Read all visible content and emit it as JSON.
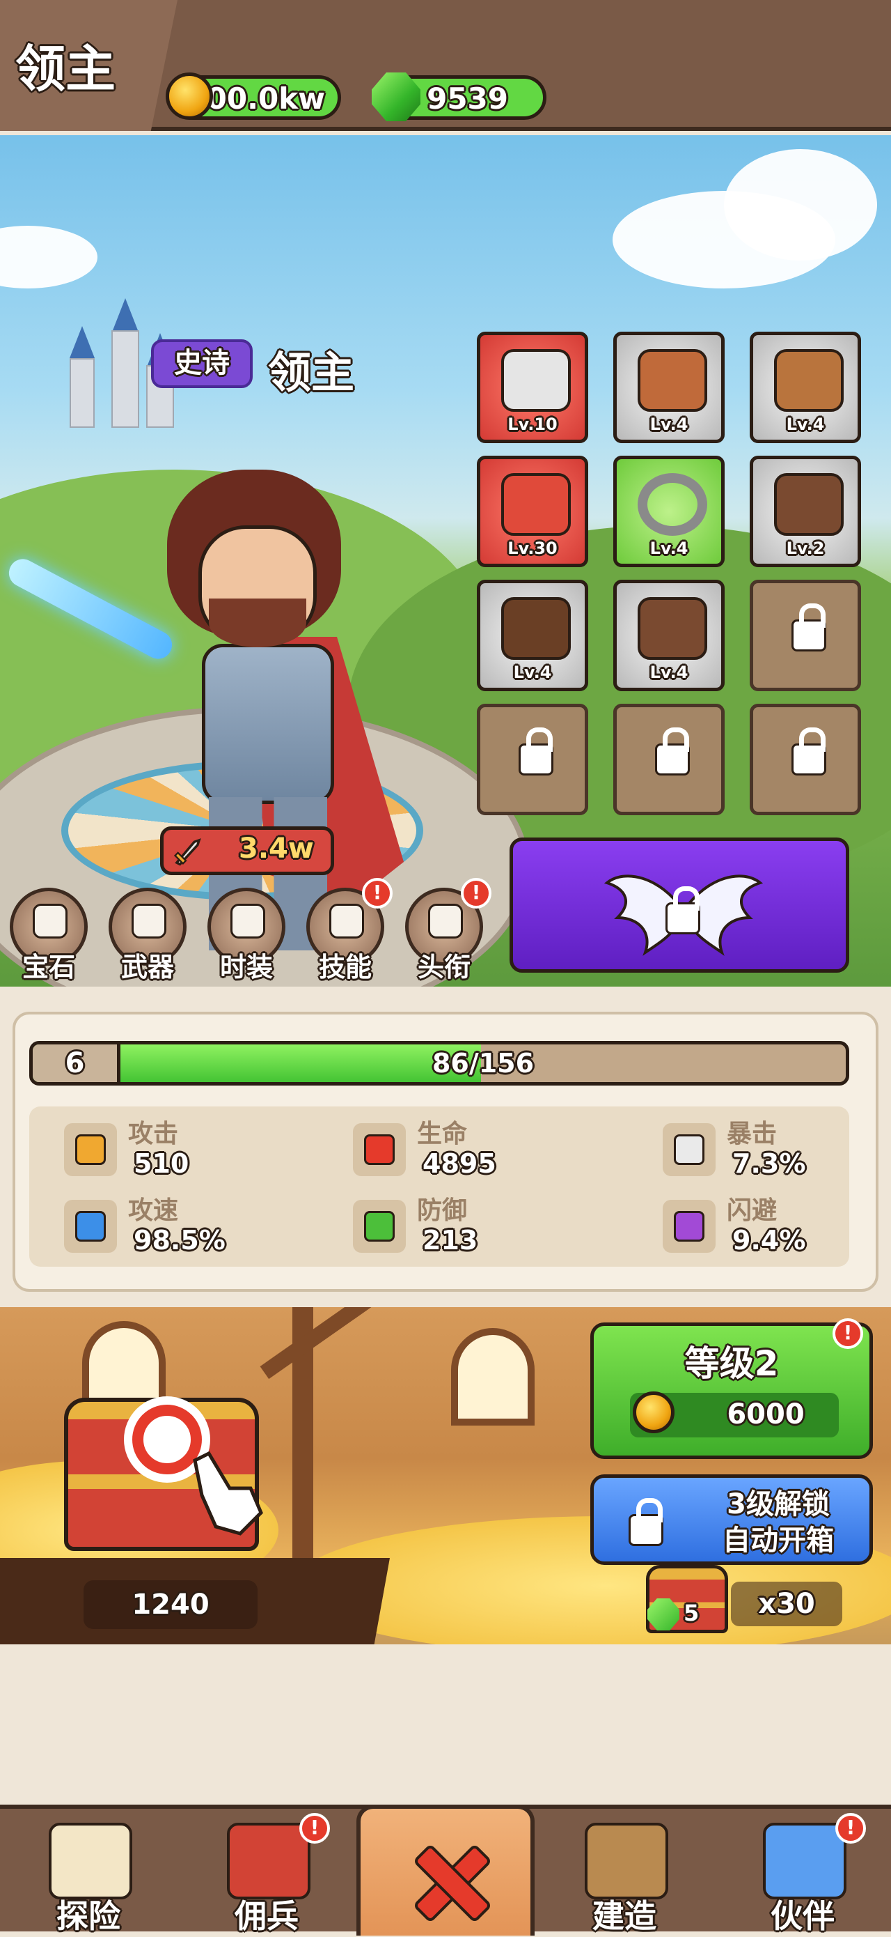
{
  "header": {
    "title": "领主",
    "coins": "100.0kw",
    "gems": "9539"
  },
  "hero": {
    "rarity": "史诗",
    "name": "领主",
    "power": "3.4w"
  },
  "equipment": [
    {
      "icon": "sword-icon",
      "level": "Lv.10",
      "rarity": "red"
    },
    {
      "icon": "helmet-icon",
      "level": "Lv.4",
      "rarity": "gray"
    },
    {
      "icon": "amulet-icon",
      "level": "Lv.4",
      "rarity": "gray"
    },
    {
      "icon": "armor-icon",
      "level": "Lv.30",
      "rarity": "red"
    },
    {
      "icon": "ring-icon",
      "level": "Lv.4",
      "rarity": "green"
    },
    {
      "icon": "gloves-icon",
      "level": "Lv.2",
      "rarity": "gray"
    },
    {
      "icon": "belt-icon",
      "level": "Lv.4",
      "rarity": "gray"
    },
    {
      "icon": "boots-icon",
      "level": "Lv.4",
      "rarity": "gray"
    }
  ],
  "menu": [
    {
      "label": "宝石",
      "icon": "gem-shield-icon",
      "alert": false
    },
    {
      "label": "武器",
      "icon": "weapon-icon",
      "alert": false
    },
    {
      "label": "时装",
      "icon": "outfit-icon",
      "alert": false
    },
    {
      "label": "技能",
      "icon": "skill-book-icon",
      "alert": true
    },
    {
      "label": "头衔",
      "icon": "crown-icon",
      "alert": true
    }
  ],
  "alert_symbol": "!",
  "stats": {
    "level": "6",
    "xp_text": "86/156",
    "xp_fraction": 0.551,
    "items": [
      {
        "name": "攻击",
        "value": "510",
        "icon": "attack-icon",
        "color": "#f0a830"
      },
      {
        "name": "生命",
        "value": "4895",
        "icon": "heart-icon",
        "color": "#e53a2b"
      },
      {
        "name": "暴击",
        "value": "7.3%",
        "icon": "dice-icon",
        "color": "#eaeaea"
      },
      {
        "name": "攻速",
        "value": "98.5%",
        "icon": "attack-speed-icon",
        "color": "#3c8fe8"
      },
      {
        "name": "防御",
        "value": "213",
        "icon": "shield-icon",
        "color": "#4cbf3a"
      },
      {
        "name": "闪避",
        "value": "9.4%",
        "icon": "boot-dodge-icon",
        "color": "#a24ad6"
      }
    ]
  },
  "treasure": {
    "chest_count": "1240",
    "upgrade_title": "等级2",
    "upgrade_cost": "6000",
    "auto_unlock_line1": "3级解锁",
    "auto_unlock_line2": "自动开箱",
    "gem_cost": "5",
    "multiplier": "x30"
  },
  "nav": [
    {
      "label": "探险",
      "icon": "map-icon",
      "alert": false
    },
    {
      "label": "佣兵",
      "icon": "scroll-icon",
      "alert": true
    },
    {
      "label": "建造",
      "icon": "build-crate-icon",
      "alert": false
    },
    {
      "label": "伙伴",
      "icon": "companion-icon",
      "alert": true
    }
  ],
  "colors": {
    "brown": "#7a5a47",
    "green": "#62d843",
    "red": "#e53a2b",
    "blue": "#2f6fe0",
    "purple": "#7b4ad4"
  }
}
